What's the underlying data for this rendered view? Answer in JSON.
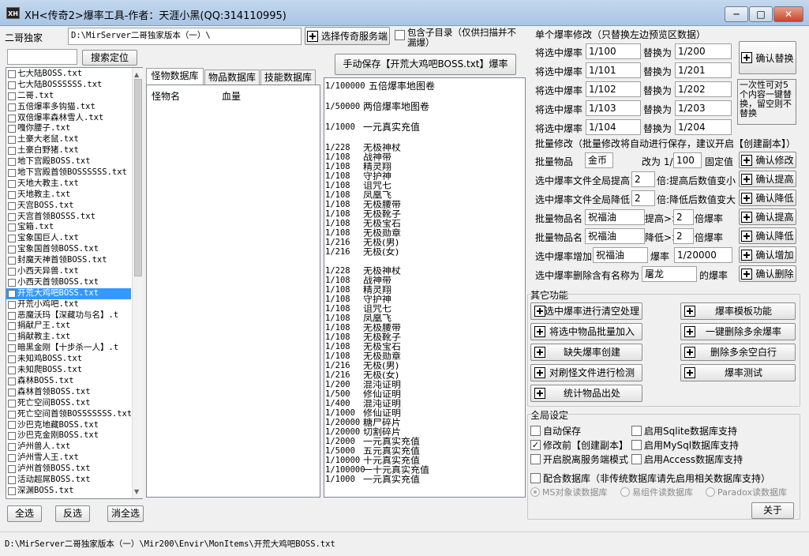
{
  "window": {
    "title": "XH<传奇2>爆率工具-作者：天涯小黑(QQ:314110995)",
    "icon_text": "XH"
  },
  "top": {
    "label": "二哥独家",
    "path": "D:\\MirServer二哥独家版本（一）\\",
    "select_server_btn": "选择传奇服务端",
    "include_subdir": "包含子目录（仅供扫描并不漏爆）",
    "search_placeholder": "",
    "search_btn": "搜索定位",
    "save_btn": "手动保存【开荒大鸡吧BOSS.txt】爆率"
  },
  "files": [
    "七大陆BOSS.txt",
    "七大陆BOSSSSSS.txt",
    "二哥.txt",
    "五倍爆率多钩猫.txt",
    "双倍爆率森林雪人.txt",
    "嘎你腰子.txt",
    "土豪大老鼠.txt",
    "土豪白野猪.txt",
    "地下宫殿BOSS.txt",
    "地下宫殿首领BOSSSSSS.txt",
    "天地大教主.txt",
    "天地教主.txt",
    "天宫BOSS.txt",
    "天宫首领BOSSS.txt",
    "宝箱.txt",
    "宝象国巨人.txt",
    "宝象国首领BOSS.txt",
    "封魔天神首领BOSS.txt",
    "小西天异兽.txt",
    "小西天首领BOSS.txt",
    "开荒大鸡吧BOSS.txt",
    "开荒小鸡吧.txt",
    "恶魔沃玛【深藏功与名】.t",
    "捐献尸王.txt",
    "捐献教主.txt",
    "暗黑金刚【十步杀一人】.t",
    "未知鸡BOSS.txt",
    "未知爬BOSS.txt",
    "森林BOSS.txt",
    "森林首领BOSS.txt",
    "死亡空间BOSS.txt",
    "死亡空间首领BOSSSSSSS.txt",
    "沙巴克地藏BOSS.txt",
    "沙巴克金刚BOSS.txt",
    "泸州兽人.txt",
    "泸州雪人王.txt",
    "泸州首领BOSS.txt",
    "活动超屌BOSS.txt",
    "深渊BOSS.txt"
  ],
  "selected_file_index": 20,
  "list_btns": {
    "all": "全选",
    "invert": "反选",
    "none": "消全选"
  },
  "tabs": [
    "怪物数据库",
    "物品数据库",
    "技能数据库"
  ],
  "monster_table": {
    "col_name": "怪物名",
    "col_hp": "血量"
  },
  "drop_lines": [
    {
      "l": "1/100000",
      "t": "五倍爆率地图卷",
      "big": 1
    },
    {
      "gap": 1
    },
    {
      "l": "1/50000",
      "t": "两倍爆率地图卷",
      "big": 1
    },
    {
      "gap": 1
    },
    {
      "l": "1/1000",
      "t": "一元真实充值",
      "big": 1
    },
    {
      "gap": 1
    },
    {
      "l": "1/228",
      "t": "无极神杖"
    },
    {
      "l": "1/108",
      "t": "战神带"
    },
    {
      "l": "1/108",
      "t": "精灵翔"
    },
    {
      "l": "1/108",
      "t": "守护神"
    },
    {
      "l": "1/108",
      "t": "诅咒七"
    },
    {
      "l": "1/108",
      "t": "凤凰飞"
    },
    {
      "l": "1/108",
      "t": "无极腰带"
    },
    {
      "l": "1/108",
      "t": "无极靴子"
    },
    {
      "l": "1/108",
      "t": "无极宝石"
    },
    {
      "l": "1/108",
      "t": "无极勋章"
    },
    {
      "l": "1/216",
      "t": "无极(男)"
    },
    {
      "l": "1/216",
      "t": "无极(女)"
    },
    {
      "gap": 1
    },
    {
      "l": "1/228",
      "t": "无极神杖"
    },
    {
      "l": "1/108",
      "t": "战神带"
    },
    {
      "l": "1/108",
      "t": "精灵翔"
    },
    {
      "l": "1/108",
      "t": "守护神"
    },
    {
      "l": "1/108",
      "t": "诅咒七"
    },
    {
      "l": "1/108",
      "t": "凤凰飞"
    },
    {
      "l": "1/108",
      "t": "无极腰带"
    },
    {
      "l": "1/108",
      "t": "无极靴子"
    },
    {
      "l": "1/108",
      "t": "无极宝石"
    },
    {
      "l": "1/108",
      "t": "无极勋章"
    },
    {
      "l": "1/216",
      "t": "无极(男)"
    },
    {
      "l": "1/216",
      "t": "无极(女)"
    },
    {
      "l": "1/200",
      "t": "混沌证明"
    },
    {
      "l": "1/500",
      "t": "修仙证明"
    },
    {
      "l": "1/400",
      "t": "混沌证明"
    },
    {
      "l": "1/1000",
      "t": "修仙证明"
    },
    {
      "l": "1/20000",
      "t": "糖尸碎片"
    },
    {
      "l": "1/20000",
      "t": "切割碎片"
    },
    {
      "l": "1/2000",
      "t": "一元真实充值"
    },
    {
      "l": "1/5000",
      "t": "五元真实充值"
    },
    {
      "l": "1/10000",
      "t": "十元真实充值"
    },
    {
      "l": "1/100000",
      "t": "        一十元真实充值"
    },
    {
      "l": "1/1000",
      "t": "一元真实充值"
    }
  ],
  "single": {
    "title": "单个爆率修改（只替换左边预览区数据）",
    "row_label": "将选中爆率",
    "replace_label": "替换为",
    "rows": [
      {
        "from": "1/100",
        "to": "1/200"
      },
      {
        "from": "1/101",
        "to": "1/201"
      },
      {
        "from": "1/102",
        "to": "1/202"
      },
      {
        "from": "1/103",
        "to": "1/203"
      },
      {
        "from": "1/104",
        "to": "1/204"
      }
    ],
    "confirm_btn": "确认替换",
    "note": "一次性可对5个内容一键替换，留空则不替换"
  },
  "batch": {
    "title": "批量修改（批量修改将自动进行保存，建议开启【创建副本】）",
    "r1": {
      "a": "批量物品",
      "v": "金币",
      "b": "改为 1/",
      "n": "100",
      "c": "固定值",
      "btn": "确认修改"
    },
    "r2": {
      "a": "选中爆率文件全局提高",
      "n": "2",
      "c": "倍:提高后数值变小",
      "btn": "确认提高"
    },
    "r3": {
      "a": "选中爆率文件全局降低",
      "n": "2",
      "c": "倍:降低后数值变大",
      "btn": "确认降低"
    },
    "r4": {
      "a": "批量物品名",
      "v": "祝福油",
      "b": "提高>>",
      "n": "2",
      "c": "倍爆率",
      "btn": "确认提高"
    },
    "r5": {
      "a": "批量物品名",
      "v": "祝福油",
      "b": "降低>>",
      "n": "2",
      "c": "倍爆率",
      "btn": "确认降低"
    },
    "r6": {
      "a": "选中爆率增加",
      "v": "祝福油",
      "b": "爆率",
      "n": "1/20000",
      "btn": "确认增加"
    },
    "r7": {
      "a": "选中爆率删除含有名称为",
      "v": "屠龙",
      "c": "的爆率",
      "btn": "确认删除"
    }
  },
  "other": {
    "title": "其它功能",
    "left": [
      "选中爆率进行清空处理",
      "将选中物品批量加入",
      "缺失爆率创建",
      "对刷怪文件进行检测",
      "统计物品出处"
    ],
    "right": [
      "爆率模板功能",
      "一键删除多余爆率",
      "删除多余空白行",
      "爆率测试"
    ]
  },
  "global": {
    "title": "全局设定",
    "left": [
      {
        "t": "自动保存",
        "c": false
      },
      {
        "t": "修改前【创建副本】",
        "c": true
      },
      {
        "t": "开启脱离服务端模式",
        "c": false
      }
    ],
    "right": [
      {
        "t": "启用Sqlite数据库支持",
        "c": false
      },
      {
        "t": "启用MySql数据库支持",
        "c": false
      },
      {
        "t": "启用Access数据库支持",
        "c": false
      }
    ],
    "db": "配合数据库（非传统数据库请先启用相关数据库支持）",
    "radios": [
      "MS对象读数据库",
      "易组件读数据库",
      "Paradox读数据库"
    ],
    "about": "关于"
  },
  "status": "D:\\MirServer二哥独家版本（一）\\Mir200\\Envir\\MonItems\\开荒大鸡吧BOSS.txt"
}
